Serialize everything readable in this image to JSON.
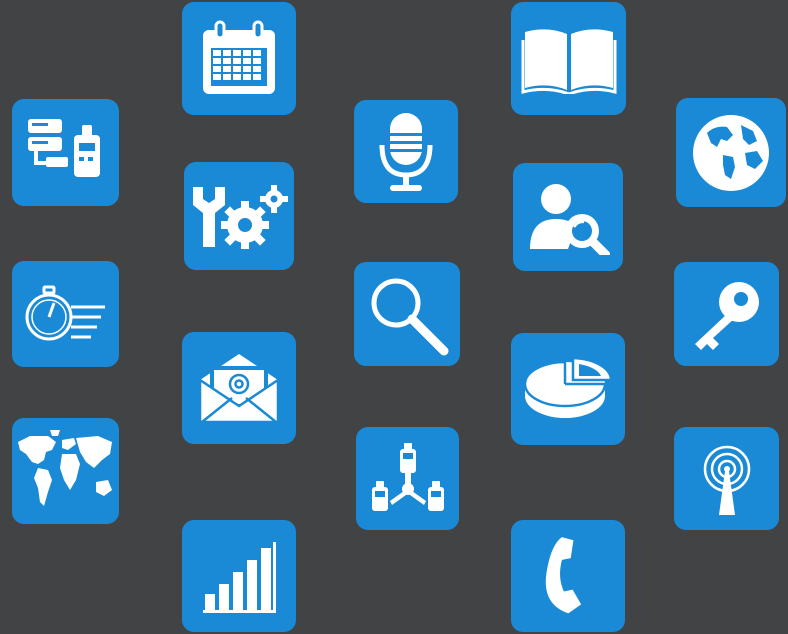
{
  "background": "#414345",
  "tile_color": "#1a8ad6",
  "icon_color": "#ffffff",
  "icons": [
    {
      "name": "server-device-icon"
    },
    {
      "name": "stopwatch-list-icon"
    },
    {
      "name": "world-map-icon"
    },
    {
      "name": "calendar-icon"
    },
    {
      "name": "tools-gears-icon"
    },
    {
      "name": "email-icon"
    },
    {
      "name": "bar-chart-icon"
    },
    {
      "name": "microphone-icon"
    },
    {
      "name": "magnifier-icon"
    },
    {
      "name": "network-devices-icon"
    },
    {
      "name": "open-book-icon"
    },
    {
      "name": "user-search-icon"
    },
    {
      "name": "pie-chart-icon"
    },
    {
      "name": "phone-icon"
    },
    {
      "name": "globe-icon"
    },
    {
      "name": "key-icon"
    },
    {
      "name": "broadcast-antenna-icon"
    }
  ]
}
